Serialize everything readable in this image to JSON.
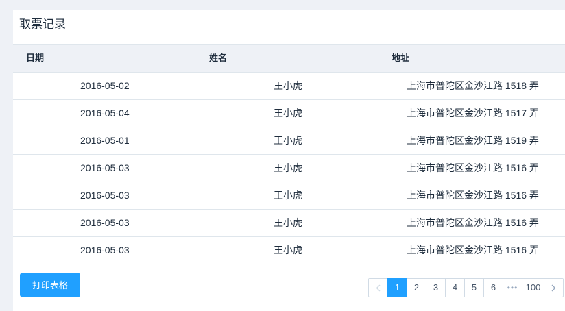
{
  "panel": {
    "title": "取票记录"
  },
  "table": {
    "columns": [
      "日期",
      "姓名",
      "地址"
    ],
    "rows": [
      {
        "date": "2016-05-02",
        "name": "王小虎",
        "address": "上海市普陀区金沙江路 1518 弄"
      },
      {
        "date": "2016-05-04",
        "name": "王小虎",
        "address": "上海市普陀区金沙江路 1517 弄"
      },
      {
        "date": "2016-05-01",
        "name": "王小虎",
        "address": "上海市普陀区金沙江路 1519 弄"
      },
      {
        "date": "2016-05-03",
        "name": "王小虎",
        "address": "上海市普陀区金沙江路 1516 弄"
      },
      {
        "date": "2016-05-03",
        "name": "王小虎",
        "address": "上海市普陀区金沙江路 1516 弄"
      },
      {
        "date": "2016-05-03",
        "name": "王小虎",
        "address": "上海市普陀区金沙江路 1516 弄"
      },
      {
        "date": "2016-05-03",
        "name": "王小虎",
        "address": "上海市普陀区金沙江路 1516 弄"
      }
    ]
  },
  "actions": {
    "print_label": "打印表格"
  },
  "pagination": {
    "pages": [
      "1",
      "2",
      "3",
      "4",
      "5",
      "6"
    ],
    "current": "1",
    "ellipsis": "•••",
    "last_page": "100",
    "icons": {
      "prev": "chevron-left-icon",
      "next": "chevron-right-icon"
    },
    "active_color": "#20a0ff"
  }
}
